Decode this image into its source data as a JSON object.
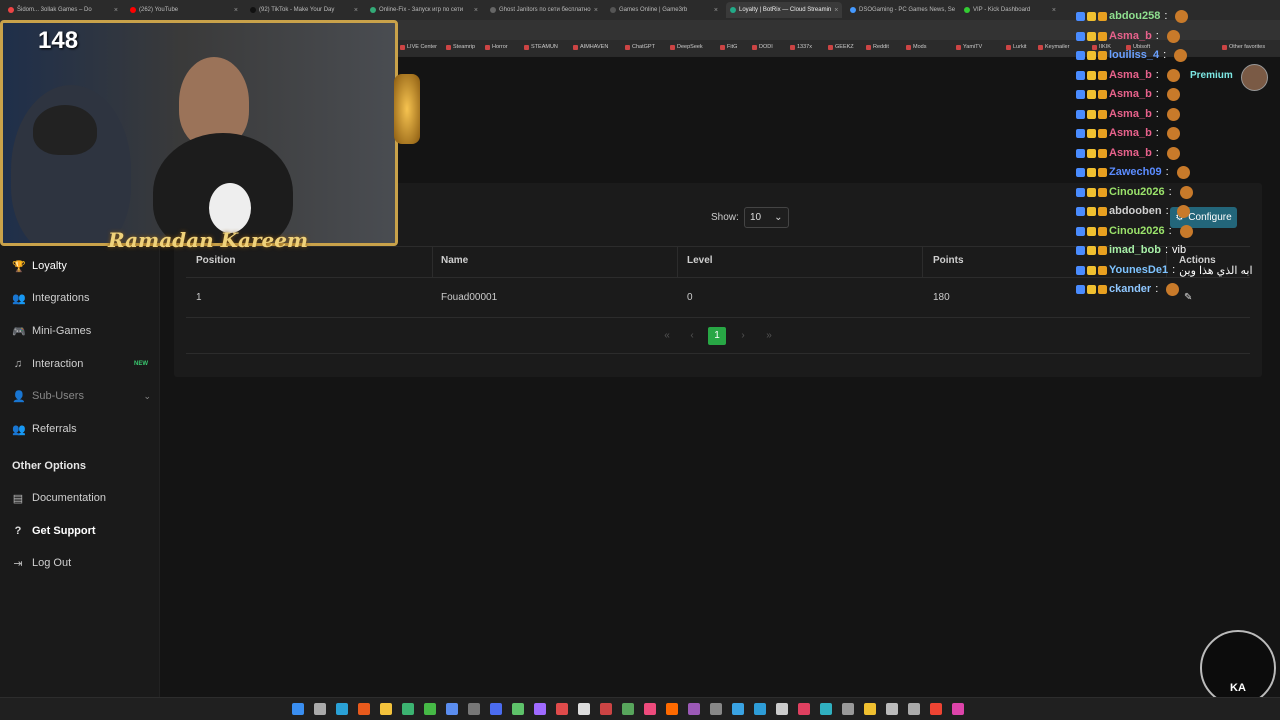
{
  "browser": {
    "tabs": [
      {
        "label": "Šidom... 3ollak Games – Do",
        "color": "#e44"
      },
      {
        "label": "(262) YouTube",
        "color": "#f00"
      },
      {
        "label": "(92) TikTok - Make Your Day",
        "color": "#111"
      },
      {
        "label": "Online-Fix - Запуск игр по сети",
        "color": "#3a7"
      },
      {
        "label": "Ghost Janitors по сети бесплатно",
        "color": "#666"
      },
      {
        "label": "Games Online | Game3rb",
        "color": "#555"
      },
      {
        "label": "Loyalty | BotRix — Cloud Streamin",
        "color": "#2a8"
      },
      {
        "label": "DSOGaming - PC Games News, Se",
        "color": "#49f"
      },
      {
        "label": "VIP - Kick Dashboard",
        "color": "#3c3"
      }
    ],
    "bookmarks": [
      "LIVE Center",
      "Steamrip",
      "Horror",
      "STEAMUN",
      "AIMHAVEN",
      "ChatGPT",
      "DeepSeek",
      "FitG",
      "DODI",
      "1337x",
      "GEEKZ",
      "Reddit",
      "Mods",
      "YamiTV",
      "Lurkit",
      "Keymailer",
      "IIKIK",
      "Ubisoft",
      "Other favorites"
    ]
  },
  "sidebar": {
    "items": [
      {
        "label": "Loyalty",
        "icon": "trophy-icon"
      },
      {
        "label": "Integrations",
        "icon": "people-icon"
      },
      {
        "label": "Mini-Games",
        "icon": "gamepad-icon"
      },
      {
        "label": "Interaction",
        "icon": "music-icon",
        "badge": "NEW"
      },
      {
        "label": "Sub-Users",
        "icon": "users-icon"
      },
      {
        "label": "Referrals",
        "icon": "people-icon"
      }
    ],
    "section_title": "Other Options",
    "other": [
      {
        "label": "Documentation",
        "icon": "book-icon"
      },
      {
        "label": "Get Support",
        "icon": "question-icon"
      },
      {
        "label": "Log Out",
        "icon": "logout-icon"
      }
    ]
  },
  "main": {
    "show_label": "Show:",
    "show_value": "10",
    "configure_label": "Configure",
    "columns": [
      "Position",
      "Name",
      "Level",
      "Points",
      "Actions"
    ],
    "rows": [
      {
        "position": "1",
        "name": "Fouad00001",
        "level": "0",
        "points": "180"
      }
    ],
    "pagination": {
      "current": "1"
    }
  },
  "stream": {
    "viewers": "148",
    "banner": "Ramadan Kareem"
  },
  "chat": [
    {
      "user": "abdou258",
      "color": "#8fe08f",
      "msg": ""
    },
    {
      "user": "Asma_b",
      "color": "#e8628c",
      "msg": ""
    },
    {
      "user": "louiliss_4",
      "color": "#6aa0ff",
      "msg": ""
    },
    {
      "user": "Asma_b",
      "color": "#e8628c",
      "msg": ""
    },
    {
      "user": "Asma_b",
      "color": "#e8628c",
      "msg": ""
    },
    {
      "user": "Asma_b",
      "color": "#e8628c",
      "msg": ""
    },
    {
      "user": "Asma_b",
      "color": "#e8628c",
      "msg": ""
    },
    {
      "user": "Asma_b",
      "color": "#e8628c",
      "msg": ""
    },
    {
      "user": "Zawech09",
      "color": "#5b8cff",
      "msg": ""
    },
    {
      "user": "Cinou2026",
      "color": "#9be36b",
      "msg": ""
    },
    {
      "user": "abdooben",
      "color": "#cfcfcf",
      "msg": ""
    },
    {
      "user": "Cinou2026",
      "color": "#9be36b",
      "msg": ""
    },
    {
      "user": "imad_bob",
      "color": "#a8f0a8",
      "msg": "vib"
    },
    {
      "user": "YounesDe1",
      "color": "#7ec3ff",
      "msg": "ابه الذي هذا وين"
    },
    {
      "user": "ckander",
      "color": "#8fc7ff",
      "msg": ""
    }
  ],
  "premium_label": "Premium",
  "logo_text": "KA"
}
